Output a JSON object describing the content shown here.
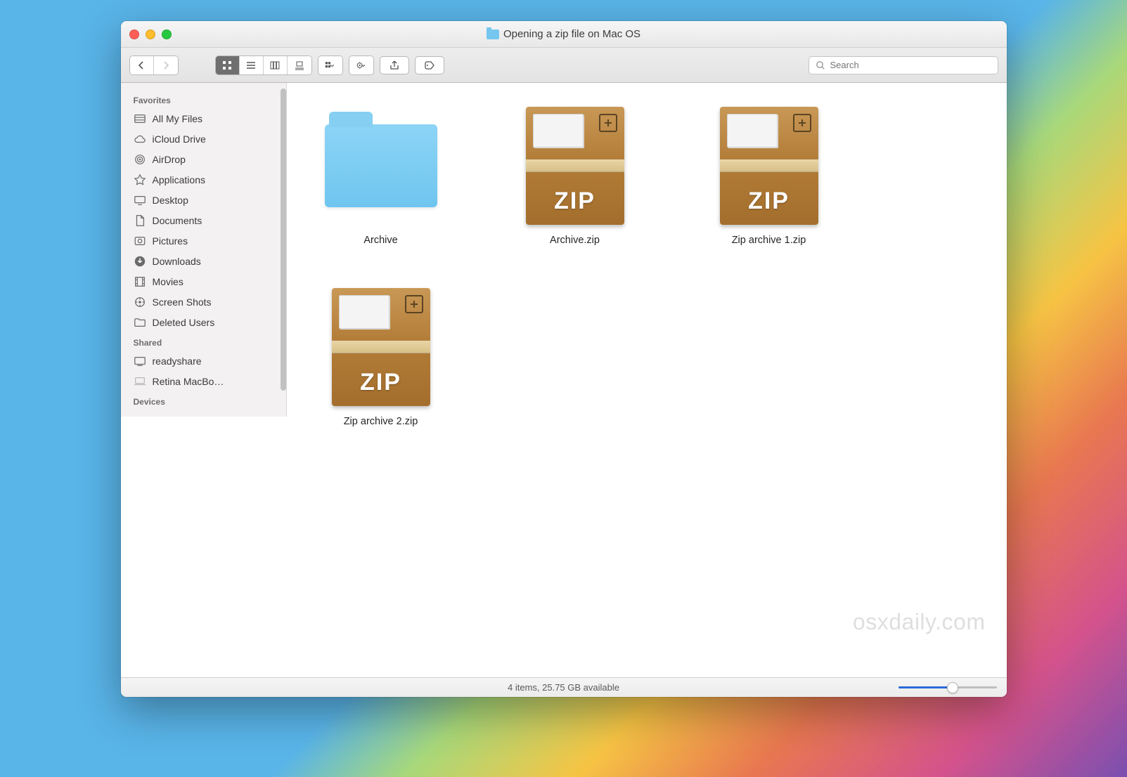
{
  "window": {
    "title": "Opening a zip file on Mac OS"
  },
  "search": {
    "placeholder": "Search"
  },
  "sidebar": {
    "sections": [
      {
        "heading": "Favorites",
        "items": [
          {
            "icon": "all-my-files-icon",
            "label": "All My Files"
          },
          {
            "icon": "icloud-icon",
            "label": "iCloud Drive"
          },
          {
            "icon": "airdrop-icon",
            "label": "AirDrop"
          },
          {
            "icon": "applications-icon",
            "label": "Applications"
          },
          {
            "icon": "desktop-icon",
            "label": "Desktop"
          },
          {
            "icon": "documents-icon",
            "label": "Documents"
          },
          {
            "icon": "pictures-icon",
            "label": "Pictures"
          },
          {
            "icon": "downloads-icon",
            "label": "Downloads"
          },
          {
            "icon": "movies-icon",
            "label": "Movies"
          },
          {
            "icon": "screenshots-icon",
            "label": "Screen Shots"
          },
          {
            "icon": "folder-icon",
            "label": "Deleted Users"
          }
        ]
      },
      {
        "heading": "Shared",
        "items": [
          {
            "icon": "network-drive-icon",
            "label": "readyshare"
          },
          {
            "icon": "laptop-icon",
            "label": "Retina MacBo…"
          }
        ]
      },
      {
        "heading": "Devices",
        "items": []
      }
    ]
  },
  "files": [
    {
      "kind": "folder",
      "name": "Archive"
    },
    {
      "kind": "zip",
      "name": "Archive.zip"
    },
    {
      "kind": "zip",
      "name": "Zip archive 1.zip"
    },
    {
      "kind": "zip",
      "name": "Zip archive 2.zip"
    }
  ],
  "status": {
    "text": "4 items, 25.75 GB available"
  },
  "watermark": "osxdaily.com",
  "zip_glyph": "ZIP"
}
